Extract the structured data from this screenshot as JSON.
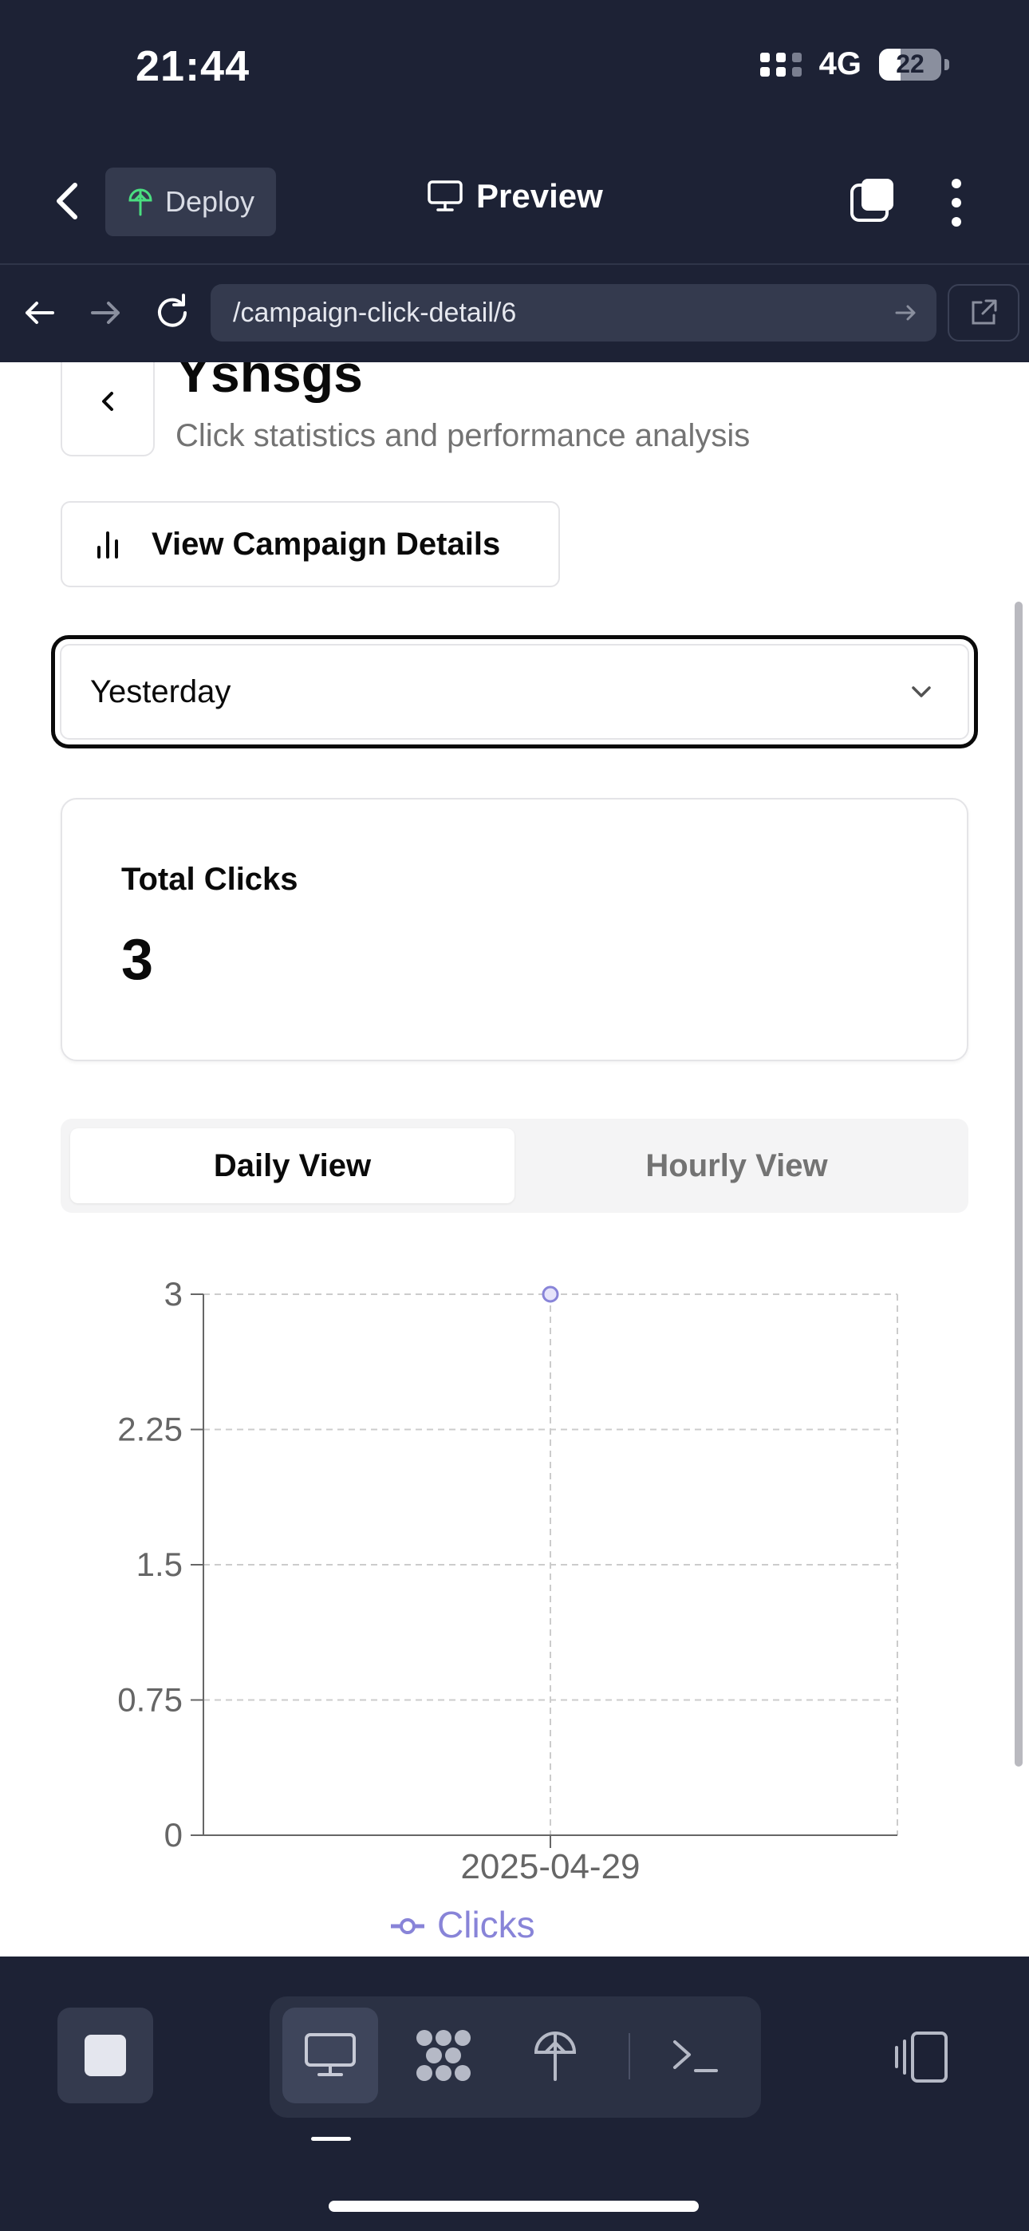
{
  "status_bar": {
    "time": "21:44",
    "network": "4G",
    "battery": "22"
  },
  "header": {
    "deploy_label": "Deploy",
    "preview_label": "Preview"
  },
  "browser": {
    "url": "/campaign-click-detail/6"
  },
  "page": {
    "title": "Yshsgs",
    "subtitle": "Click statistics and performance analysis",
    "campaign_button_label": "View Campaign Details",
    "period_select": {
      "value": "Yesterday"
    },
    "total_clicks": {
      "label": "Total Clicks",
      "value": "3"
    },
    "view_tabs": [
      {
        "label": "Daily View",
        "active": true
      },
      {
        "label": "Hourly View",
        "active": false
      }
    ]
  },
  "chart_data": {
    "type": "line",
    "x": [
      "2025-04-29"
    ],
    "series": [
      {
        "name": "Clicks",
        "values": [
          3
        ],
        "color": "#8884d8"
      }
    ],
    "yticks": [
      "0",
      "0.75",
      "1.5",
      "2.25",
      "3"
    ],
    "ylim": [
      0,
      3
    ],
    "grid": true,
    "legend": "bottom"
  },
  "colors": {
    "dark_bg": "#1d2235",
    "accent": "#8884d8"
  }
}
